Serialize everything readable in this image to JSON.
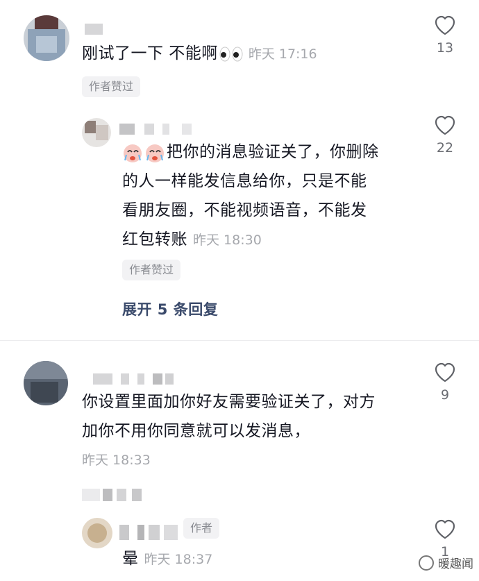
{
  "comments": [
    {
      "text": "刚试了一下 不能啊",
      "time": "昨天 17:16",
      "badge": "作者赞过",
      "likes": "13"
    },
    {
      "line1": "把你的消息验证关了，你删除",
      "line2": "的人一样能发信息给你，只是不能",
      "line3": "看朋友圈，不能视频语音，不能发",
      "line4": "红包转账",
      "time": "昨天 18:30",
      "badge": "作者赞过",
      "likes": "22",
      "expand": "展开 5 条回复"
    },
    {
      "line1": "你设置里面加你好友需要验证关了，对方",
      "line2": "加你不用你同意就可以发消息，",
      "time": "昨天 18:33",
      "likes": "9"
    },
    {
      "author_tag": "作者",
      "text": "晕",
      "time": "昨天 18:37",
      "likes": "1"
    }
  ],
  "watermark": "暖趣闻",
  "icons": {
    "like": "heart-outline-icon",
    "emoji_eyes": "eyes-emoji-icon",
    "emoji_cry": "crying-face-emoji-icon",
    "watermark": "wechat-logo-icon"
  },
  "colors": {
    "text": "#161823",
    "muted": "#a6a8ad",
    "link": "#3a4a6b"
  }
}
